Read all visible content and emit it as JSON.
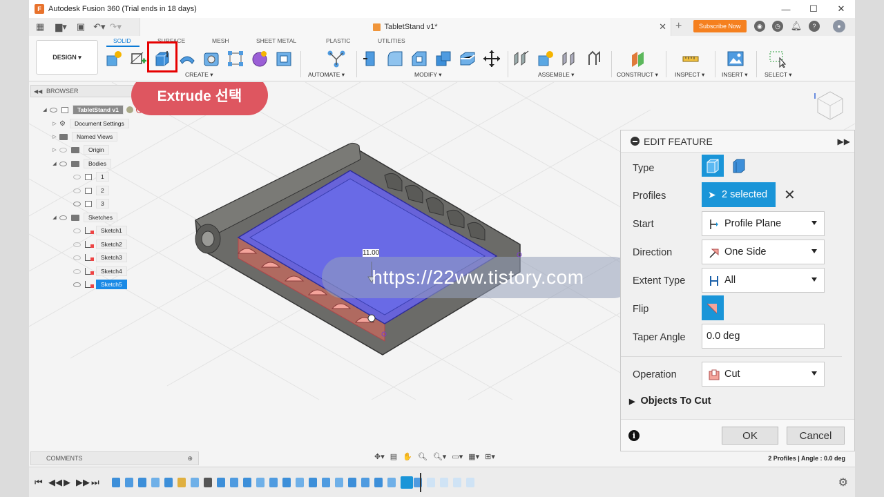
{
  "window": {
    "title": "Autodesk Fusion 360 (Trial ends in 18 days)",
    "minimize": "—",
    "maximize": "☐",
    "close": "✕"
  },
  "tabbar": {
    "document_tab": "TabletStand v1*",
    "close": "✕",
    "new_tab": "+",
    "subscribe": "Subscribe Now"
  },
  "ribbon": {
    "workspace": "DESIGN ▾",
    "modes": [
      "SOLID",
      "SURFACE",
      "MESH",
      "SHEET METAL",
      "PLASTIC",
      "UTILITIES"
    ],
    "groups": [
      "CREATE ▾",
      "AUTOMATE ▾",
      "MODIFY ▾",
      "ASSEMBLE ▾",
      "CONSTRUCT ▾",
      "INSPECT ▾",
      "INSERT ▾",
      "SELECT ▾"
    ]
  },
  "callout": "Extrude 선택",
  "browser": {
    "header": "BROWSER",
    "root": "TabletStand v1",
    "items": {
      "document_settings": "Document Settings",
      "named_views": "Named Views",
      "origin": "Origin",
      "bodies": "Bodies",
      "body1": "1",
      "body2": "2",
      "body3": "3",
      "sketches": "Sketches",
      "sketch1": "Sketch1",
      "sketch2": "Sketch2",
      "sketch3": "Sketch3",
      "sketch4": "Sketch4",
      "sketch5": "Sketch5"
    }
  },
  "viewport": {
    "dimension": "11.00",
    "watermark": "https://22ww.tistory.com"
  },
  "edit_feature": {
    "title": "EDIT FEATURE",
    "type_label": "Type",
    "profiles_label": "Profiles",
    "profiles_value": "2 selected",
    "start_label": "Start",
    "start_value": "Profile Plane",
    "direction_label": "Direction",
    "direction_value": "One Side",
    "extent_label": "Extent Type",
    "extent_value": "All",
    "flip_label": "Flip",
    "taper_label": "Taper Angle",
    "taper_value": "0.0 deg",
    "operation_label": "Operation",
    "operation_value": "Cut",
    "objects_to_cut": "Objects To Cut",
    "ok": "OK",
    "cancel": "Cancel"
  },
  "comments": "COMMENTS",
  "status": "2 Profiles | Angle : 0.0 deg",
  "colors": {
    "accent": "#0a7ad6",
    "selected_blue": "#1a95d8",
    "callout": "#de5660",
    "highlight": "#e60000"
  }
}
